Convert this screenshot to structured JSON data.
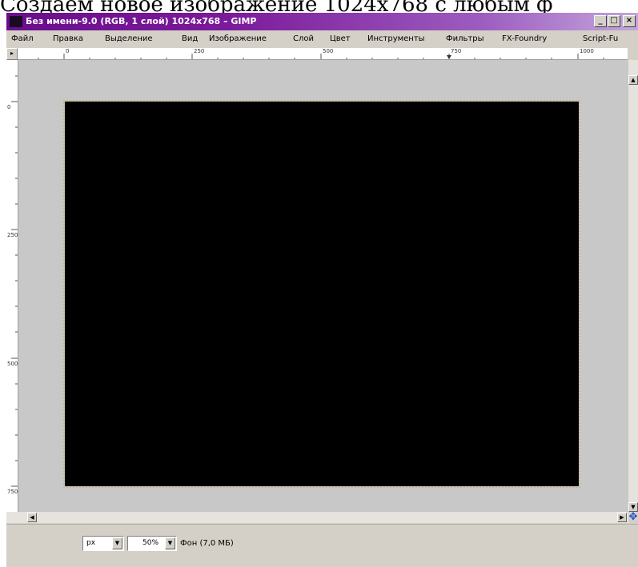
{
  "caption": "Создаем новое изображение 1024x768 с любым ф",
  "window": {
    "title": "Без имени-9.0 (RGB, 1 слой) 1024x768 – GIMP",
    "controls": {
      "minimize": "_",
      "maximize": "□",
      "close": "×"
    }
  },
  "menu": [
    "Файл",
    "Правка",
    "Выделение",
    "Вид",
    "Изображение",
    "Слой",
    "Цвет",
    "Инструменты",
    "Фильтры",
    "FX-Foundry",
    "Script-Fu"
  ],
  "ruler": {
    "top_labels": [
      "0",
      "250",
      "500",
      "750",
      "1000"
    ],
    "left_labels": [
      "0",
      "250",
      "500",
      "750"
    ]
  },
  "image": {
    "fill": "#000000",
    "selection_color": "#c8b88a"
  },
  "statusbar": {
    "unit": "px",
    "zoom": "50%",
    "layer_info": "Фон (7,0 МБ)"
  },
  "colors": {
    "titlebar_start": "#6a0e8c",
    "titlebar_end": "#c4a6dc",
    "window_bg": "#d4d0c8",
    "canvas_bg": "#c8c8c8",
    "nav_icon": "#1a4fd0"
  },
  "icons": {
    "corner": "quick-mask-icon",
    "navigate": "navigate-icon",
    "dropdown": "chevron-down-icon"
  }
}
